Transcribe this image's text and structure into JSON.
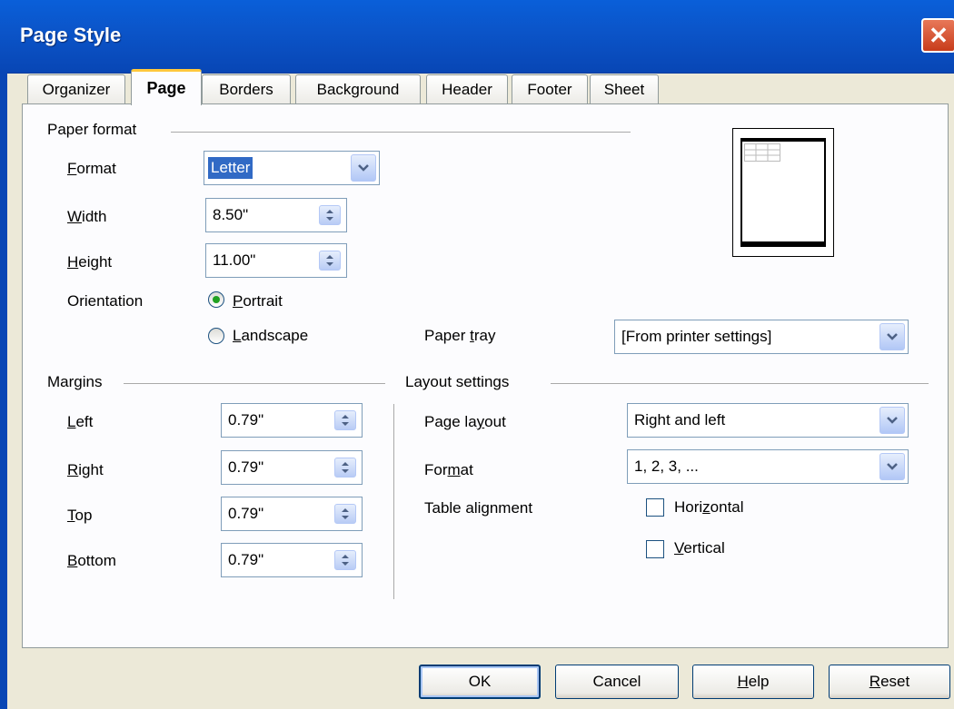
{
  "window": {
    "title": "Page Style"
  },
  "tabs": [
    "Organizer",
    "Page",
    "Borders",
    "Background",
    "Header",
    "Footer",
    "Sheet"
  ],
  "active_tab": "Page",
  "paper_format": {
    "section": "Paper format",
    "format_label_pre": "F",
    "format_label_post": "ormat",
    "format_value": "Letter",
    "width_label_pre": "W",
    "width_label_post": "idth",
    "width_value": "8.50\"",
    "height_label_pre": "H",
    "height_label_post": "eight",
    "height_value": "11.00\"",
    "orientation_label": "Orientation",
    "portrait_pre": "P",
    "portrait_post": "ortrait",
    "landscape_pre": "L",
    "landscape_post": "andscape",
    "orientation_selected": "Portrait",
    "paper_tray_pre": "Paper ",
    "paper_tray_u": "t",
    "paper_tray_post": "ray",
    "paper_tray_value": "[From printer settings]"
  },
  "margins": {
    "section": "Margins",
    "left_pre": "L",
    "left_post": "eft",
    "left_value": "0.79\"",
    "right_pre": "R",
    "right_post": "ight",
    "right_value": "0.79\"",
    "top_pre": "T",
    "top_post": "op",
    "top_value": "0.79\"",
    "bottom_pre": "B",
    "bottom_post": "ottom",
    "bottom_value": "0.79\""
  },
  "layout_settings": {
    "section": "Layout settings",
    "page_layout_pre": "Page la",
    "page_layout_u": "y",
    "page_layout_post": "out",
    "page_layout_value": "Right and left",
    "format_pre": "For",
    "format_u": "m",
    "format_post": "at",
    "format_value": "1, 2, 3, ...",
    "table_alignment_label": "Table alignment",
    "horizontal_pre": "Hori",
    "horizontal_u": "z",
    "horizontal_post": "ontal",
    "vertical_pre": "",
    "vertical_u": "V",
    "vertical_post": "ertical",
    "horizontal_checked": false,
    "vertical_checked": false
  },
  "buttons": {
    "ok": "OK",
    "cancel": "Cancel",
    "help_u": "H",
    "help_post": "elp",
    "reset_u": "R",
    "reset_post": "eset"
  },
  "colors": {
    "titlebar": "#0A5FD9",
    "dialog_bg": "#ECE9D8",
    "panel_bg": "#FCFCFE",
    "selection": "#316AC5",
    "active_tab_accent": "#FFC83C"
  }
}
